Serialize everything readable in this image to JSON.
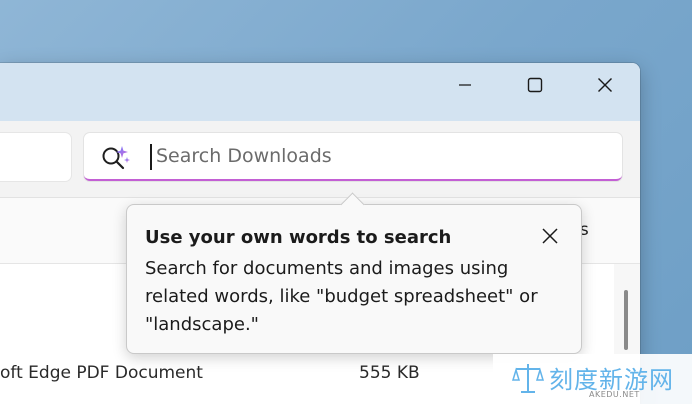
{
  "window": {
    "controls": {
      "minimize_icon": "minimize-icon",
      "maximize_icon": "maximize-icon",
      "close_icon": "close-icon"
    }
  },
  "search": {
    "placeholder": "Search Downloads",
    "value": "",
    "icon": "ai-search-sparkle-icon",
    "accent_color": "#c35fd4"
  },
  "commandbar": {
    "details_label": "ails"
  },
  "tooltip": {
    "title": "Use your own words to search",
    "body": "Search for documents and images using related words, like \"budget spreadsheet\" or \"landscape.\"",
    "close_icon": "close-icon"
  },
  "file_list": {
    "rows": [
      {
        "type": "oft Edge PDF Document",
        "size": "555 KB"
      }
    ]
  },
  "watermark": {
    "name": "刻度新游网",
    "url": "AKEDU.NET"
  }
}
